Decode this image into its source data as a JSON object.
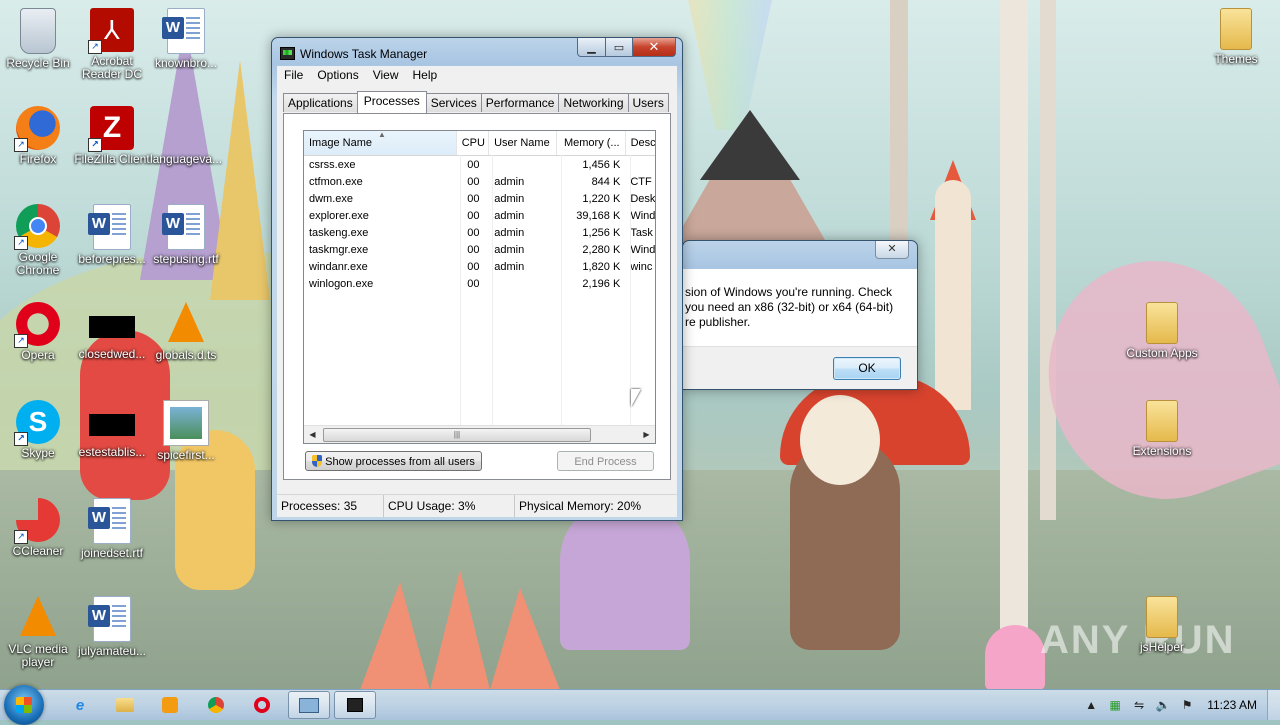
{
  "desktop_icons": [
    {
      "label": "Recycle Bin"
    },
    {
      "label": "Acrobat Reader DC"
    },
    {
      "label": "knownbro..."
    },
    {
      "label": "Firefox"
    },
    {
      "label": "FileZilla Client"
    },
    {
      "label": "languageva..."
    },
    {
      "label": "Google Chrome"
    },
    {
      "label": "beforepres..."
    },
    {
      "label": "stepusing.rtf"
    },
    {
      "label": "Opera"
    },
    {
      "label": "closedwed..."
    },
    {
      "label": "globals.d.ts"
    },
    {
      "label": "Skype"
    },
    {
      "label": "estestablis..."
    },
    {
      "label": "spicefirst..."
    },
    {
      "label": "CCleaner"
    },
    {
      "label": "joinedset.rtf"
    },
    {
      "label": "VLC media player"
    },
    {
      "label": "julyamateu..."
    },
    {
      "label": "Themes"
    },
    {
      "label": "Custom Apps"
    },
    {
      "label": "Extensions"
    },
    {
      "label": "jsHelper"
    }
  ],
  "task_manager": {
    "title": "Windows Task Manager",
    "menu": [
      "File",
      "Options",
      "View",
      "Help"
    ],
    "tabs": [
      "Applications",
      "Processes",
      "Services",
      "Performance",
      "Networking",
      "Users"
    ],
    "active_tab": "Processes",
    "columns": [
      "Image Name",
      "CPU",
      "User Name",
      "Memory (...",
      "Desc"
    ],
    "rows": [
      {
        "name": "csrss.exe",
        "cpu": "00",
        "user": "",
        "memory": "1,456 K",
        "desc": ""
      },
      {
        "name": "ctfmon.exe",
        "cpu": "00",
        "user": "admin",
        "memory": "844 K",
        "desc": "CTF"
      },
      {
        "name": "dwm.exe",
        "cpu": "00",
        "user": "admin",
        "memory": "1,220 K",
        "desc": "Desk"
      },
      {
        "name": "explorer.exe",
        "cpu": "00",
        "user": "admin",
        "memory": "39,168 K",
        "desc": "Wind"
      },
      {
        "name": "taskeng.exe",
        "cpu": "00",
        "user": "admin",
        "memory": "1,256 K",
        "desc": "Task"
      },
      {
        "name": "taskmgr.exe",
        "cpu": "00",
        "user": "admin",
        "memory": "2,280 K",
        "desc": "Wind"
      },
      {
        "name": "windanr.exe",
        "cpu": "00",
        "user": "admin",
        "memory": "1,820 K",
        "desc": "winc"
      },
      {
        "name": "winlogon.exe",
        "cpu": "00",
        "user": "",
        "memory": "2,196 K",
        "desc": ""
      }
    ],
    "show_all_label": "Show processes from all users",
    "end_process_label": "End Process",
    "status": {
      "processes": "Processes: 35",
      "cpu": "CPU Usage: 3%",
      "memory": "Physical Memory: 20%"
    }
  },
  "dialog": {
    "lines": [
      "sion of Windows you're running. Check",
      "you need an x86 (32-bit) or x64 (64-bit)",
      "re publisher."
    ],
    "ok_label": "OK"
  },
  "taskbar": {
    "clock": "11:23 AM"
  },
  "watermark": "ANY RUN",
  "colors": {
    "titlebar": "#bcd4ea",
    "close_button": "#c7432b",
    "taskbar": "#a8c4de"
  }
}
